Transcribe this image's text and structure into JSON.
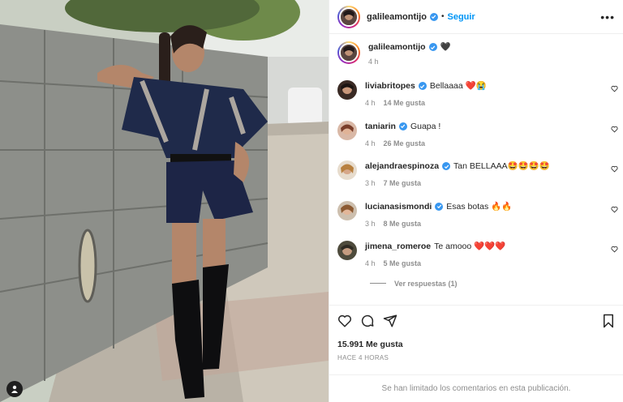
{
  "post": {
    "username": "galileamontijo",
    "follow_label": "Seguir",
    "more_label": "•••",
    "caption_text": "🖤",
    "caption_time": "4 h",
    "likes": "15.991 Me gusta",
    "time_ago": "HACE 4 HORAS",
    "comments_limited": "Se han limitado los comentarios en esta publicación.",
    "replies_label": "Ver respuestas (1)"
  },
  "comments": [
    {
      "user": "liviabritopes",
      "verified": true,
      "text": "Bellaaaa ❤️😭",
      "time": "4 h",
      "likes": "14 Me gusta"
    },
    {
      "user": "taniarin",
      "verified": true,
      "text": "Guapa !",
      "time": "4 h",
      "likes": "26 Me gusta"
    },
    {
      "user": "alejandraespinoza",
      "verified": true,
      "text": "Tan BELLAAA🤩🤩🤩🤩",
      "time": "3 h",
      "likes": "7 Me gusta"
    },
    {
      "user": "lucianasismondi",
      "verified": true,
      "text": "Esas botas 🔥🔥",
      "time": "3 h",
      "likes": "8 Me gusta"
    },
    {
      "user": "jimena_romeroe",
      "verified": false,
      "text": "Te amooo ❤️❤️❤️",
      "time": "4 h",
      "likes": "5 Me gusta"
    }
  ],
  "icons": {
    "verified": "verified-badge-icon",
    "like": "heart-icon",
    "comment": "comment-icon",
    "share": "share-icon",
    "save": "bookmark-icon",
    "tag": "user-tag-icon"
  },
  "colors": {
    "accent": "#0095f6",
    "verified": "#3897f0",
    "muted": "#8e8e8e",
    "text": "#262626"
  }
}
